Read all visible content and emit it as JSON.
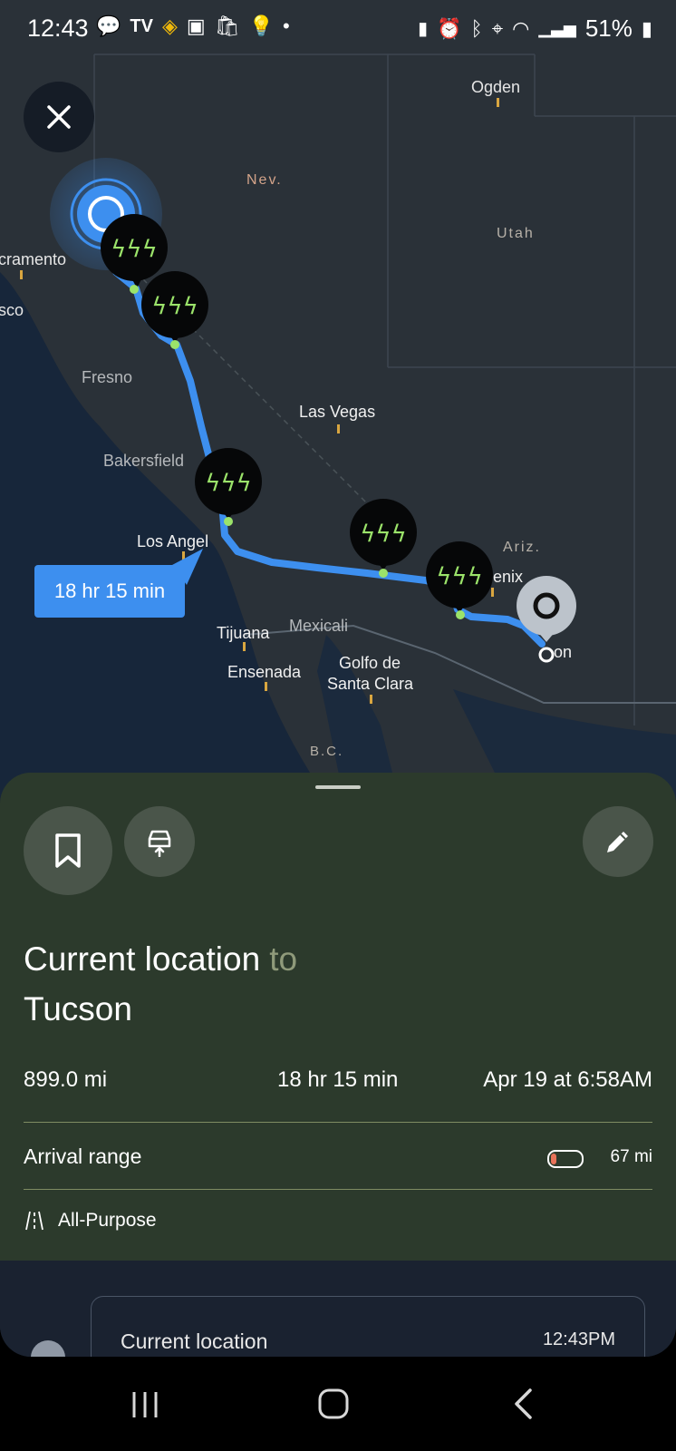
{
  "status": {
    "time": "12:43",
    "battery": "51%"
  },
  "map": {
    "labels": [
      "Ogden",
      "Nev.",
      "Utah",
      "cramento",
      "sco",
      "Fresno",
      "Las Vegas",
      "Bakersfield",
      "Los Angel",
      "Ariz.",
      "enix",
      "Tijuana",
      "Mexicali",
      "Ensenada",
      "Golfo de",
      "Santa Clara",
      "B.C.",
      "on"
    ],
    "eta_callout": "18 hr 15 min",
    "route_color": "#3d8fef",
    "charger_color": "#9be36a"
  },
  "route": {
    "from": "Current location",
    "to_word": "to",
    "destination": "Tucson",
    "distance": "899.0 mi",
    "duration": "18 hr 15 min",
    "arrival": "Apr 19 at 6:58AM",
    "arrival_range_label": "Arrival range",
    "arrival_range_value": "67 mi",
    "arrival_range_level": 0.2,
    "road_type": "All-Purpose"
  },
  "itinerary": {
    "first_stop": "Current location",
    "first_time": "12:43PM"
  }
}
